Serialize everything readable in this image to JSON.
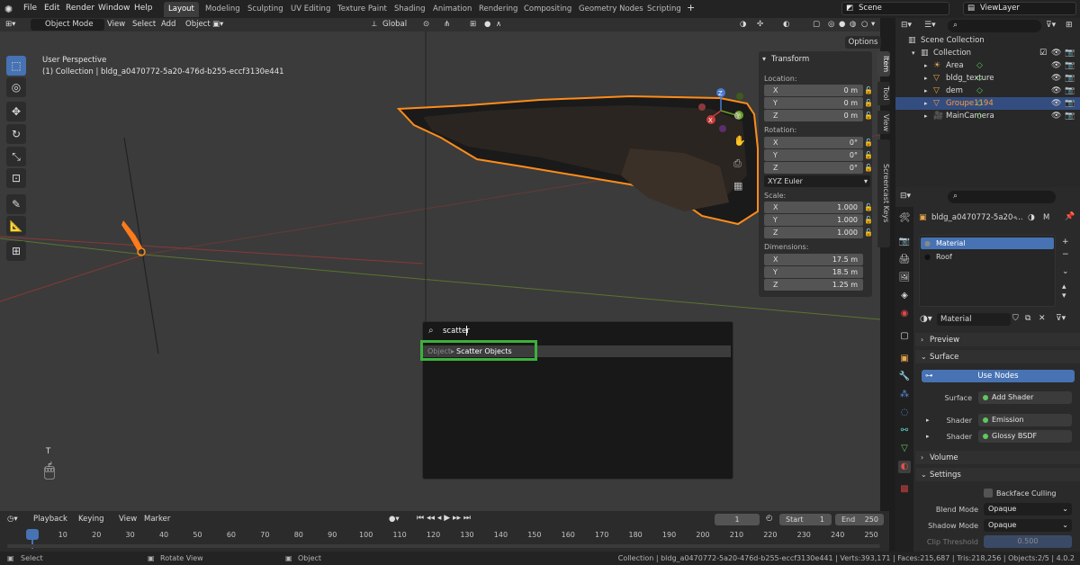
{
  "menus": [
    "File",
    "Edit",
    "Render",
    "Window",
    "Help"
  ],
  "workspaces": [
    "Layout",
    "Modeling",
    "Sculpting",
    "UV Editing",
    "Texture Paint",
    "Shading",
    "Animation",
    "Rendering",
    "Compositing",
    "Geometry Nodes",
    "Scripting"
  ],
  "active_workspace": "Layout",
  "scene": "Scene",
  "view_layer": "ViewLayer",
  "viewport_header": {
    "mode": "Object Mode",
    "view": "View",
    "select": "Select",
    "add": "Add",
    "object": "Object",
    "orientation": "Global",
    "options": "Options"
  },
  "viewport": {
    "perspective": "User Perspective",
    "collection_line": "(1) Collection | bldg_a0470772-5a20-476d-b255-eccf3130e441",
    "gizmo": {
      "z": "Z",
      "y": "Y",
      "x": "X"
    },
    "corner_label": "T"
  },
  "transform": {
    "title": "Transform",
    "location_label": "Location:",
    "location": [
      {
        "axis": "X",
        "value": "0 m"
      },
      {
        "axis": "Y",
        "value": "0 m"
      },
      {
        "axis": "Z",
        "value": "0 m"
      }
    ],
    "rotation_label": "Rotation:",
    "rotation": [
      {
        "axis": "X",
        "value": "0°"
      },
      {
        "axis": "Y",
        "value": "0°"
      },
      {
        "axis": "Z",
        "value": "0°"
      }
    ],
    "rotation_mode": "XYZ Euler",
    "scale_label": "Scale:",
    "scale": [
      {
        "axis": "X",
        "value": "1.000"
      },
      {
        "axis": "Y",
        "value": "1.000"
      },
      {
        "axis": "Z",
        "value": "1.000"
      }
    ],
    "dimensions_label": "Dimensions:",
    "dimensions": [
      {
        "axis": "X",
        "value": "17.5 m"
      },
      {
        "axis": "Y",
        "value": "18.5 m"
      },
      {
        "axis": "Z",
        "value": "1.25 m"
      }
    ]
  },
  "side_tabs": [
    "Item",
    "Tool",
    "View",
    "Screencast Keys"
  ],
  "search_popup": {
    "query": "scatter",
    "result_prefix": "Object",
    "result_sep": "▸",
    "result_name": "Scatter Objects"
  },
  "timeline": {
    "playback": "Playback",
    "keying": "Keying",
    "view": "View",
    "marker": "Marker",
    "current_frame": "1",
    "start_label": "Start",
    "start": "1",
    "end_label": "End",
    "end": "250",
    "ticks": [
      "1",
      "10",
      "20",
      "30",
      "40",
      "50",
      "60",
      "70",
      "80",
      "90",
      "100",
      "110",
      "120",
      "130",
      "140",
      "150",
      "160",
      "170",
      "180",
      "190",
      "200",
      "210",
      "220",
      "230",
      "240",
      "250"
    ]
  },
  "status_bar": {
    "select": "Select",
    "rotate": "Rotate View",
    "object": "Object",
    "stats": "Collection | bldg_a0470772-5a20-476d-b255-eccf3130e441 | Verts:393,171 | Faces:215,687 | Tris:218,256 | Objects:2/5 | 4.0.2"
  },
  "outliner": {
    "root": "Scene Collection",
    "collection": "Collection",
    "items": [
      {
        "name": "Area",
        "icon": "light-icon",
        "color": "#e8a64c"
      },
      {
        "name": "bldg_texture",
        "icon": "mesh-icon",
        "color": "#e8a64c"
      },
      {
        "name": "dem",
        "icon": "mesh-icon",
        "color": "#e8a64c"
      },
      {
        "name": "Groupe1194",
        "icon": "mesh-icon",
        "color": "#e8a64c",
        "selected": true
      },
      {
        "name": "MainCamera",
        "icon": "camera-icon",
        "color": "#e8a64c"
      }
    ]
  },
  "properties": {
    "object_name": "bldg_a0470772-5a20-...",
    "object_suffix": "M",
    "slots": [
      {
        "name": "Material",
        "active": true
      },
      {
        "name": "Roof",
        "active": false
      }
    ],
    "material_field": "Material",
    "sections": {
      "preview": "Preview",
      "surface": "Surface",
      "volume": "Volume",
      "settings": "Settings"
    },
    "use_nodes": "Use Nodes",
    "surface_label": "Surface",
    "surface_value": "Add Shader",
    "shader_label": "Shader",
    "shader1": "Emission",
    "shader2": "Glossy BSDF",
    "backface_culling": "Backface Culling",
    "blend_mode_label": "Blend Mode",
    "blend_mode": "Opaque",
    "shadow_mode_label": "Shadow Mode",
    "shadow_mode": "Opaque",
    "clip_threshold_label": "Clip Threshold",
    "clip_threshold": "0.500"
  },
  "colors": {
    "accent": "#4772b3",
    "highlight": "#3db03d",
    "selection_orange": "#ff8c1a"
  }
}
